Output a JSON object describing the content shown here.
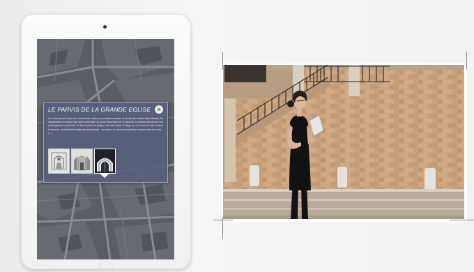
{
  "popup": {
    "title": "LE PARVIS DE LA GRANDE EGLISE",
    "close_glyph": "×",
    "body": "Les colonnes de l'avant nef, vérant butte contre les premières marches de révèle de la rétine Saint-Maurice, les constructeurs du Moyen Âge durent aménager un parvis descendant de 11 marches. La façade était percée d'un portail gothique présentant, de face et place du ghique, une riche statue. Protégé par un auvent de bois on sorte fermement, ce portail était également polychromé ; au-dessus, le vitrail annonçait leur toujours entre les murs... [...]",
    "thumbnails": [
      {
        "label": "thumbnail-1"
      },
      {
        "label": "thumbnail-2"
      },
      {
        "label": "thumbnail-3"
      }
    ]
  },
  "colors": {
    "popup_bg": "#58607c",
    "map_bg": "#5a5c63",
    "stone": "#c7a17c"
  }
}
